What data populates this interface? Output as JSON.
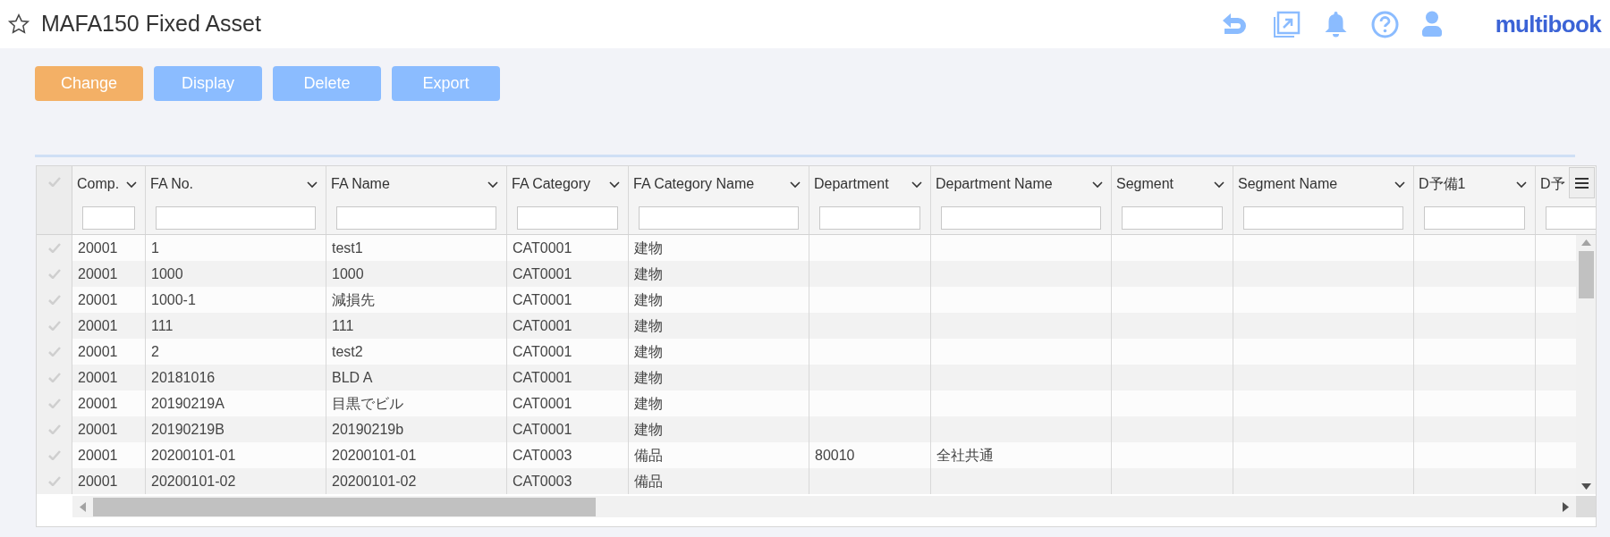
{
  "header": {
    "title": "MAFA150 Fixed Asset",
    "logo": "multibook"
  },
  "toolbar": [
    {
      "label": "Change",
      "kind": "primary"
    },
    {
      "label": "Display",
      "kind": "default"
    },
    {
      "label": "Delete",
      "kind": "default"
    },
    {
      "label": "Export",
      "kind": "default"
    }
  ],
  "table": {
    "select_all": {
      "checked": false
    },
    "columns": [
      {
        "label": "Comp."
      },
      {
        "label": "FA No."
      },
      {
        "label": "FA Name"
      },
      {
        "label": "FA Category"
      },
      {
        "label": "FA Category Name"
      },
      {
        "label": "Department"
      },
      {
        "label": "Department Name"
      },
      {
        "label": "Segment"
      },
      {
        "label": "Segment Name"
      },
      {
        "label": "D予備1"
      },
      {
        "label": "D予"
      }
    ],
    "rows": [
      {
        "checked": false,
        "cells": [
          "20001",
          "1",
          "test1",
          "CAT0001",
          "建物"
        ]
      },
      {
        "checked": false,
        "cells": [
          "20001",
          "1000",
          "1000",
          "CAT0001",
          "建物"
        ]
      },
      {
        "checked": false,
        "cells": [
          "20001",
          "1000-1",
          "減損先",
          "CAT0001",
          "建物"
        ]
      },
      {
        "checked": false,
        "cells": [
          "20001",
          "111",
          "111",
          "CAT0001",
          "建物"
        ]
      },
      {
        "checked": false,
        "cells": [
          "20001",
          "2",
          "test2",
          "CAT0001",
          "建物"
        ]
      },
      {
        "checked": false,
        "cells": [
          "20001",
          "20181016",
          "BLD A",
          "CAT0001",
          "建物"
        ]
      },
      {
        "checked": false,
        "cells": [
          "20001",
          "20190219A",
          "目黒でビル",
          "CAT0001",
          "建物"
        ]
      },
      {
        "checked": false,
        "cells": [
          "20001",
          "20190219B",
          "20190219b",
          "CAT0001",
          "建物"
        ]
      },
      {
        "checked": false,
        "cells": [
          "20001",
          "20200101-01",
          "20200101-01",
          "CAT0003",
          "備品",
          "80010",
          "全社共通"
        ]
      },
      {
        "checked": false,
        "cells": [
          "20001",
          "20200101-02",
          "20200101-02",
          "CAT0003",
          "備品"
        ]
      }
    ]
  }
}
